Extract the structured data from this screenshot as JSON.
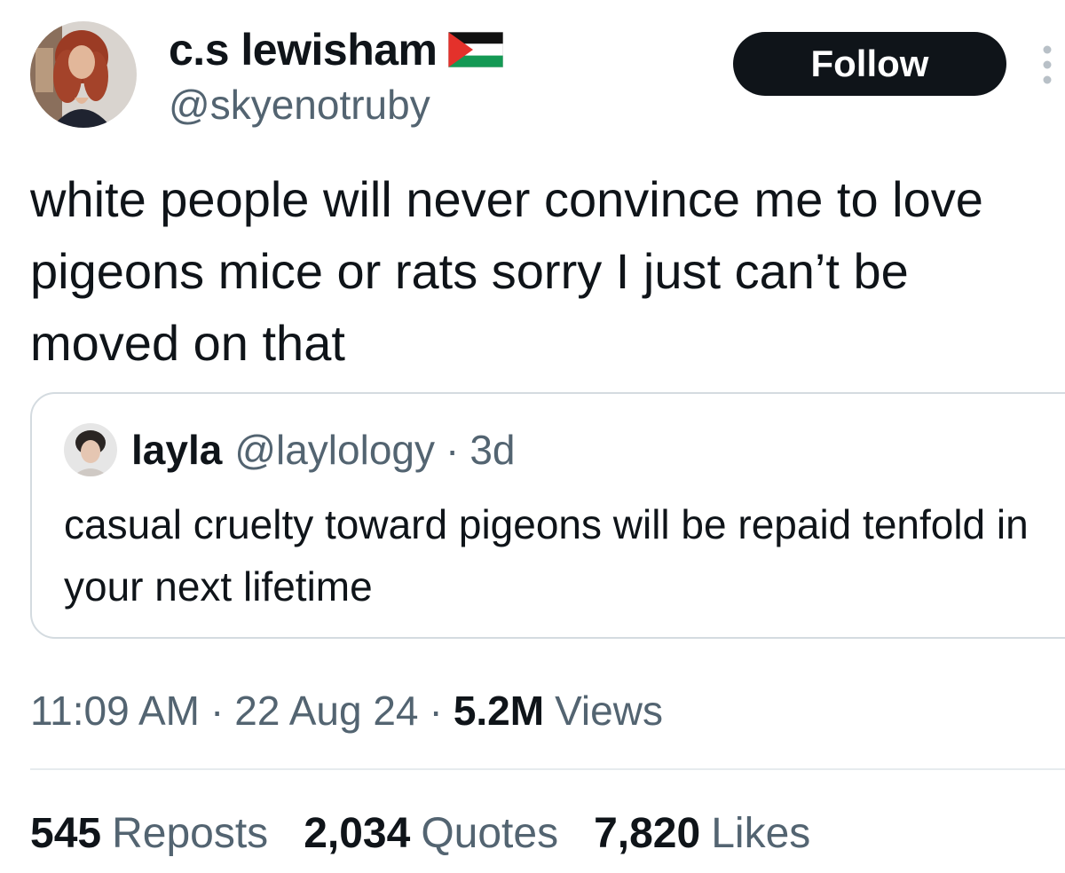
{
  "tweet": {
    "author": {
      "display_name": "c.s lewisham",
      "handle": "@skyenotruby",
      "avatar": "profile-photo",
      "badge": "palestine-flag-icon"
    },
    "follow_label": "Follow",
    "more_icon": "more-options-icon",
    "text": "white people will never convince me to love pigeons mice or rats sorry I just can’t be moved on that",
    "quote": {
      "display_name": "layla",
      "handle": "@laylology",
      "separator": "·",
      "time": "3d",
      "text": "casual cruelty toward pigeons will be repaid tenfold in your next lifetime"
    },
    "meta": {
      "time": "11:09 AM",
      "separator": "·",
      "date": "22 Aug 24",
      "views_count": "5.2M",
      "views_label": "Views"
    },
    "stats": {
      "reposts_count": "545",
      "reposts_label": "Reposts",
      "quotes_count": "2,034",
      "quotes_label": "Quotes",
      "likes_count": "7,820",
      "likes_label": "Likes"
    }
  },
  "colors": {
    "text_primary": "#0f1419",
    "text_secondary": "#536471",
    "button_bg": "#0f1419",
    "border": "#d4dbe0"
  }
}
